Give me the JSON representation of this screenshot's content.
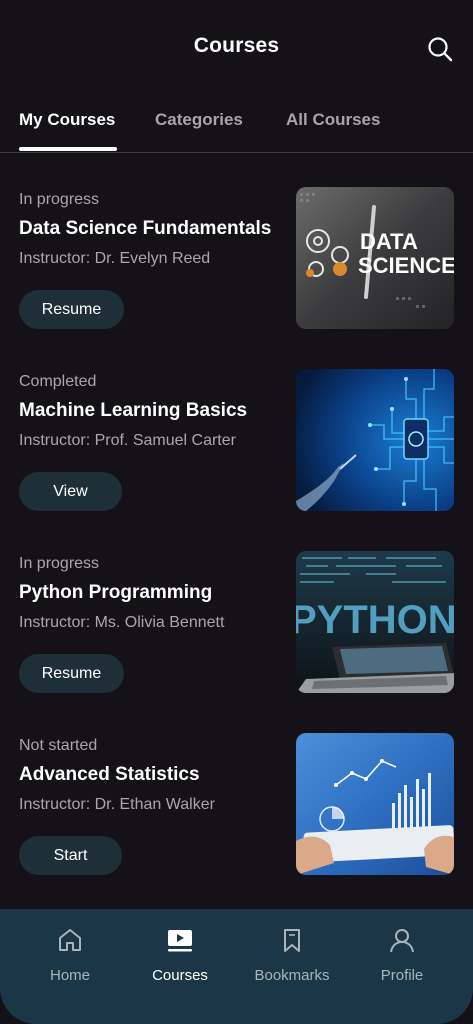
{
  "header": {
    "title": "Courses",
    "search_icon": "search-icon"
  },
  "tabs": [
    {
      "label": "My Courses",
      "active": true
    },
    {
      "label": "Categories",
      "active": false
    },
    {
      "label": "All Courses",
      "active": false
    }
  ],
  "courses": [
    {
      "status": "In progress",
      "name": "Data Science Fundamentals",
      "instructor": "Instructor: Dr. Evelyn Reed",
      "action": "Resume",
      "thumb_text": "DATA SCIENCE"
    },
    {
      "status": "Completed",
      "name": "Machine Learning Basics",
      "instructor": "Instructor: Prof. Samuel Carter",
      "action": "View"
    },
    {
      "status": "In progress",
      "name": "Python Programming",
      "instructor": "Instructor: Ms. Olivia Bennett",
      "action": "Resume",
      "thumb_text": "PYTHON"
    },
    {
      "status": "Not started",
      "name": "Advanced Statistics",
      "instructor": "Instructor: Dr. Ethan Walker",
      "action": "Start"
    }
  ],
  "nav": [
    {
      "label": "Home",
      "icon": "home-icon",
      "active": false
    },
    {
      "label": "Courses",
      "icon": "play-icon",
      "active": true
    },
    {
      "label": "Bookmarks",
      "icon": "bookmark-icon",
      "active": false
    },
    {
      "label": "Profile",
      "icon": "profile-icon",
      "active": false
    }
  ],
  "colors": {
    "background": "#141218",
    "button": "#1f2f38",
    "nav_background": "#1b3747",
    "muted_text": "#a9a6b0"
  }
}
